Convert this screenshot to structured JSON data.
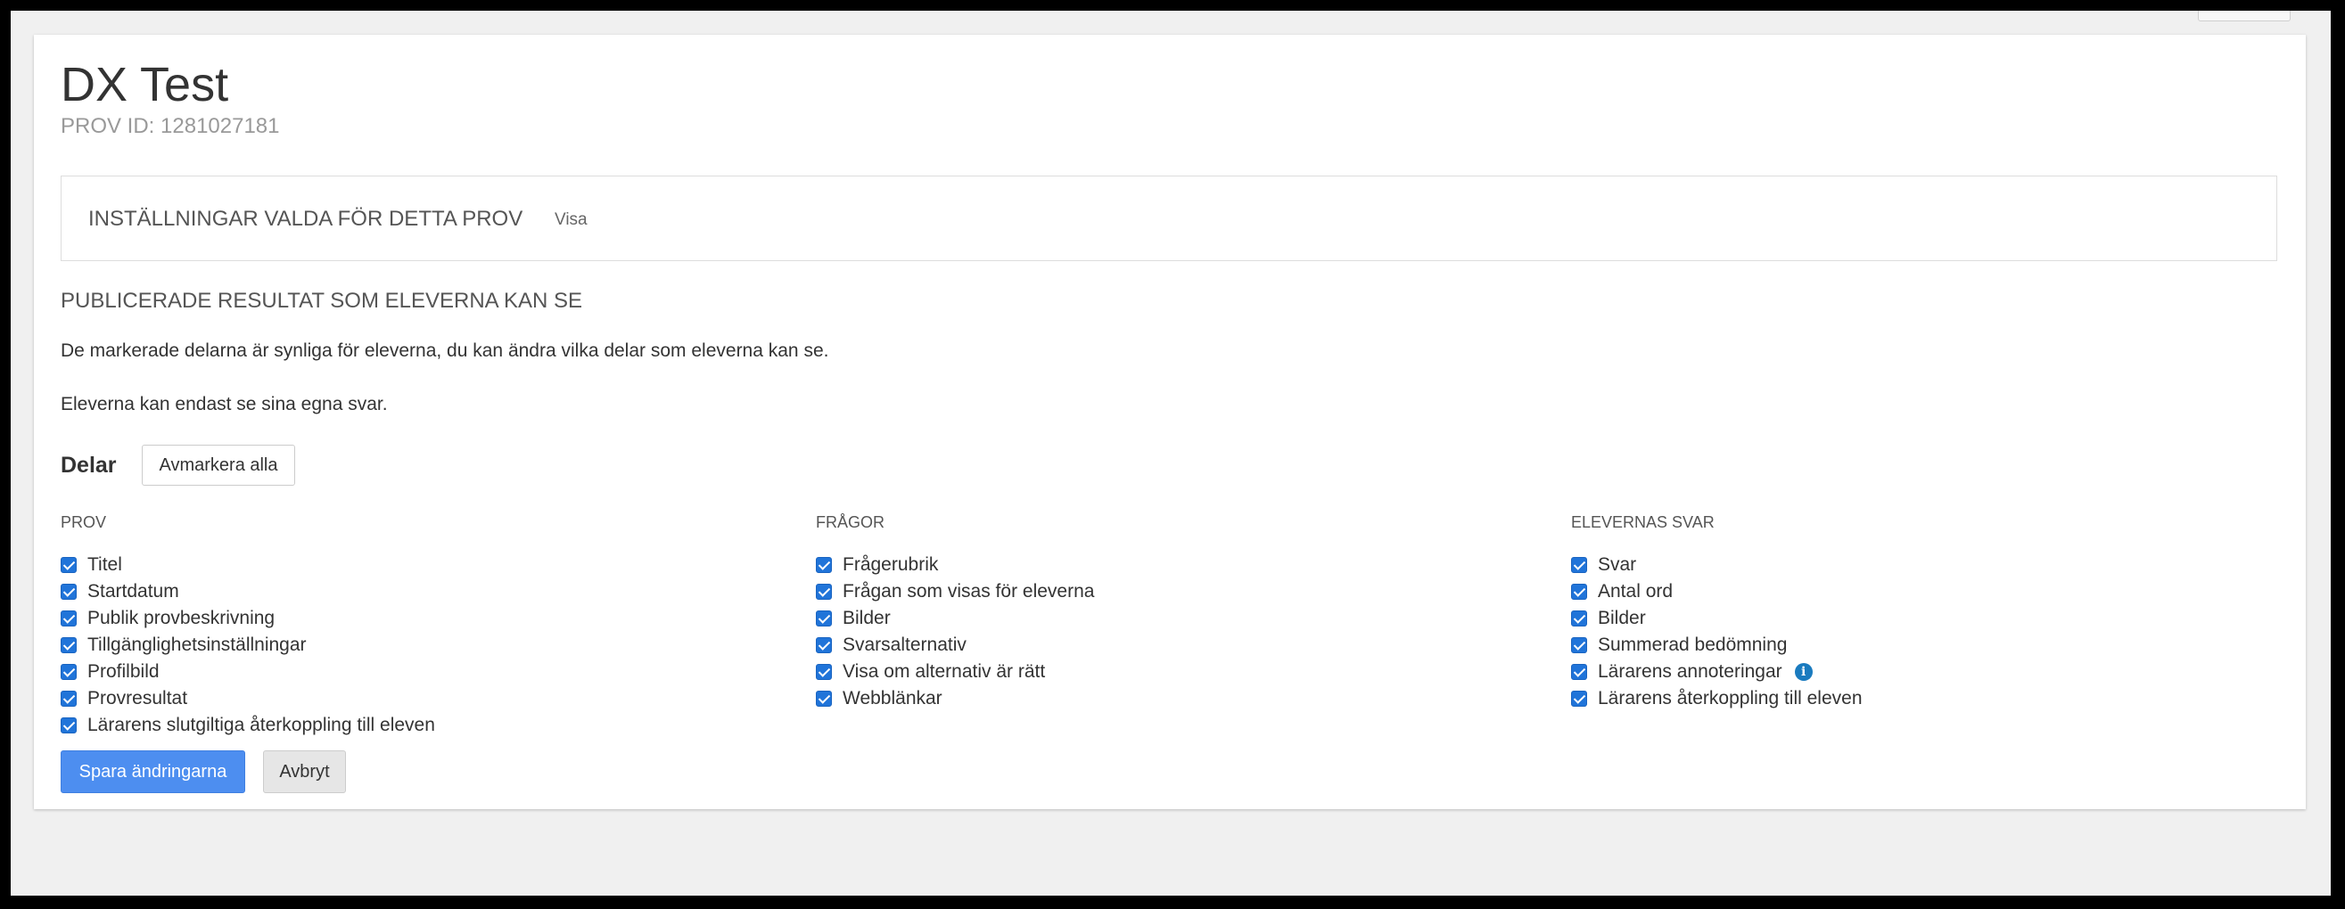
{
  "page": {
    "title": "DX Test",
    "prov_id": "PROV ID: 1281027181"
  },
  "settings": {
    "heading": "INSTÄLLNINGAR VALDA FÖR DETTA PROV",
    "show_link": "Visa"
  },
  "results": {
    "heading": "PUBLICERADE RESULTAT SOM ELEVERNA KAN SE",
    "info_line_1": "De markerade delarna är synliga för eleverna, du kan ändra vilka delar som eleverna kan se.",
    "info_line_2": "Eleverna kan endast se sina egna svar.",
    "parts_label": "Delar",
    "unmark_all_label": "Avmarkera alla"
  },
  "columns": [
    {
      "heading": "PROV",
      "items": [
        {
          "label": "Titel",
          "checked": true
        },
        {
          "label": "Startdatum",
          "checked": true
        },
        {
          "label": "Publik provbeskrivning",
          "checked": true
        },
        {
          "label": "Tillgänglighetsinställningar",
          "checked": true
        },
        {
          "label": "Profilbild",
          "checked": true
        },
        {
          "label": "Provresultat",
          "checked": true
        },
        {
          "label": "Lärarens slutgiltiga återkoppling till eleven",
          "checked": true
        }
      ]
    },
    {
      "heading": "FRÅGOR",
      "items": [
        {
          "label": "Frågerubrik",
          "checked": true
        },
        {
          "label": "Frågan som visas för eleverna",
          "checked": true
        },
        {
          "label": "Bilder",
          "checked": true
        },
        {
          "label": "Svarsalternativ",
          "checked": true
        },
        {
          "label": "Visa om alternativ är rätt",
          "checked": true
        },
        {
          "label": "Webblänkar",
          "checked": true
        }
      ]
    },
    {
      "heading": "ELEVERNAS SVAR",
      "items": [
        {
          "label": "Svar",
          "checked": true
        },
        {
          "label": "Antal ord",
          "checked": true
        },
        {
          "label": "Bilder",
          "checked": true
        },
        {
          "label": "Summerad bedömning",
          "checked": true
        },
        {
          "label": "Lärarens annoteringar",
          "checked": true,
          "info_icon": "info-icon"
        },
        {
          "label": "Lärarens återkoppling till eleven",
          "checked": true
        }
      ]
    }
  ],
  "actions": {
    "save_label": "Spara ändringarna",
    "cancel_label": "Avbryt"
  },
  "colors": {
    "primary_button": "#4d8ef0",
    "checkbox": "#2074d9",
    "info_icon": "#1a7bbf"
  }
}
